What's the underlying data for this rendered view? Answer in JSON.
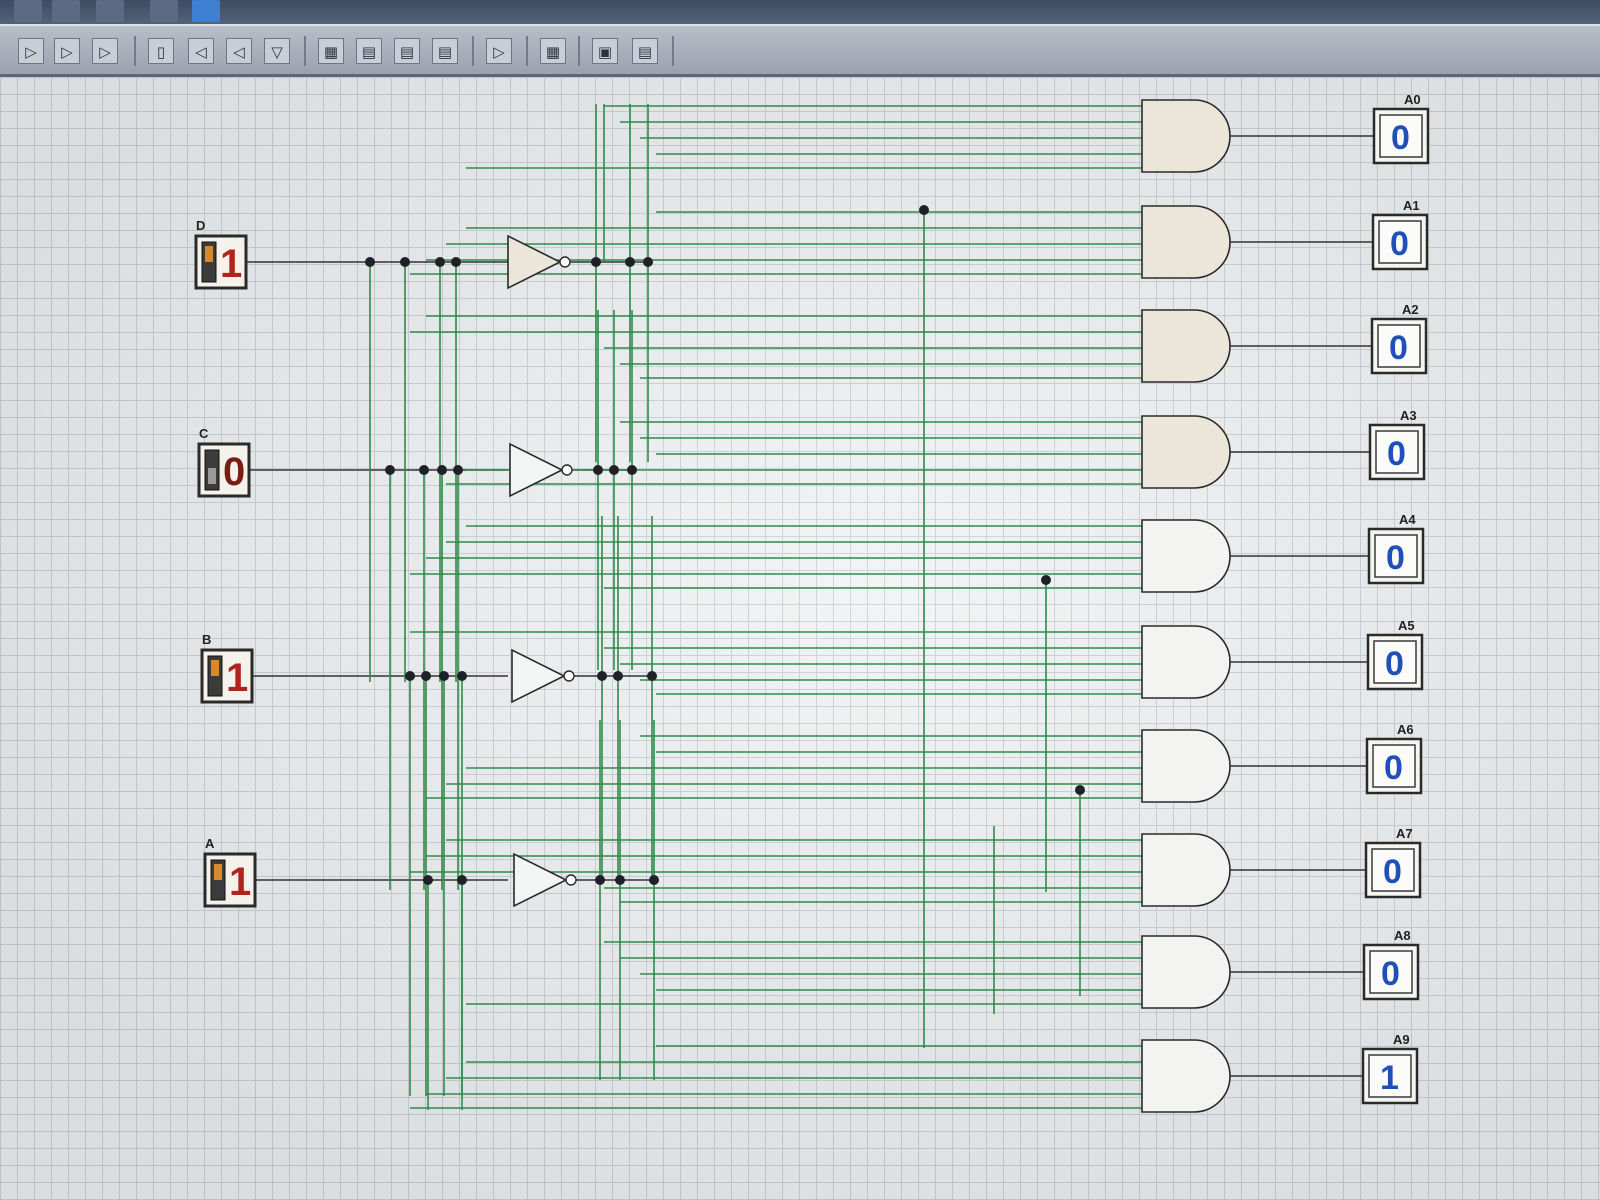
{
  "toolbar": {
    "top_icons": [
      "zoom-in-icon",
      "zoom-out-icon",
      "hand-icon",
      "run-icon",
      "save-icon"
    ],
    "tools": [
      "buffer-gate-icon",
      "nand-gate-icon",
      "nor-gate-icon",
      "not-gate-icon",
      "xor-gate-icon",
      "multiplexer-icon",
      "decoder-icon",
      "flip-flop-icon",
      "register-icon",
      "counter-icon",
      "memory-icon",
      "and-gate-icon",
      "grid-icon",
      "display-icon",
      "chip-icon"
    ]
  },
  "circuit": {
    "inputs": [
      {
        "label": "D",
        "value": "1"
      },
      {
        "label": "C",
        "value": "0"
      },
      {
        "label": "B",
        "value": "1"
      },
      {
        "label": "A",
        "value": "1"
      }
    ],
    "outputs": [
      {
        "label": "A0",
        "value": "0"
      },
      {
        "label": "A1",
        "value": "0"
      },
      {
        "label": "A2",
        "value": "0"
      },
      {
        "label": "A3",
        "value": "0"
      },
      {
        "label": "A4",
        "value": "0"
      },
      {
        "label": "A5",
        "value": "0"
      },
      {
        "label": "A6",
        "value": "0"
      },
      {
        "label": "A7",
        "value": "0"
      },
      {
        "label": "A8",
        "value": "0"
      },
      {
        "label": "A9",
        "value": "1"
      }
    ],
    "colors": {
      "wire": "#2f8a4a",
      "wire_dark": "#333333",
      "input_high": "#b0241e",
      "input_low": "#7a1c14",
      "output_digit": "#1f4fb8",
      "gate_fill": "#ece6da"
    }
  }
}
